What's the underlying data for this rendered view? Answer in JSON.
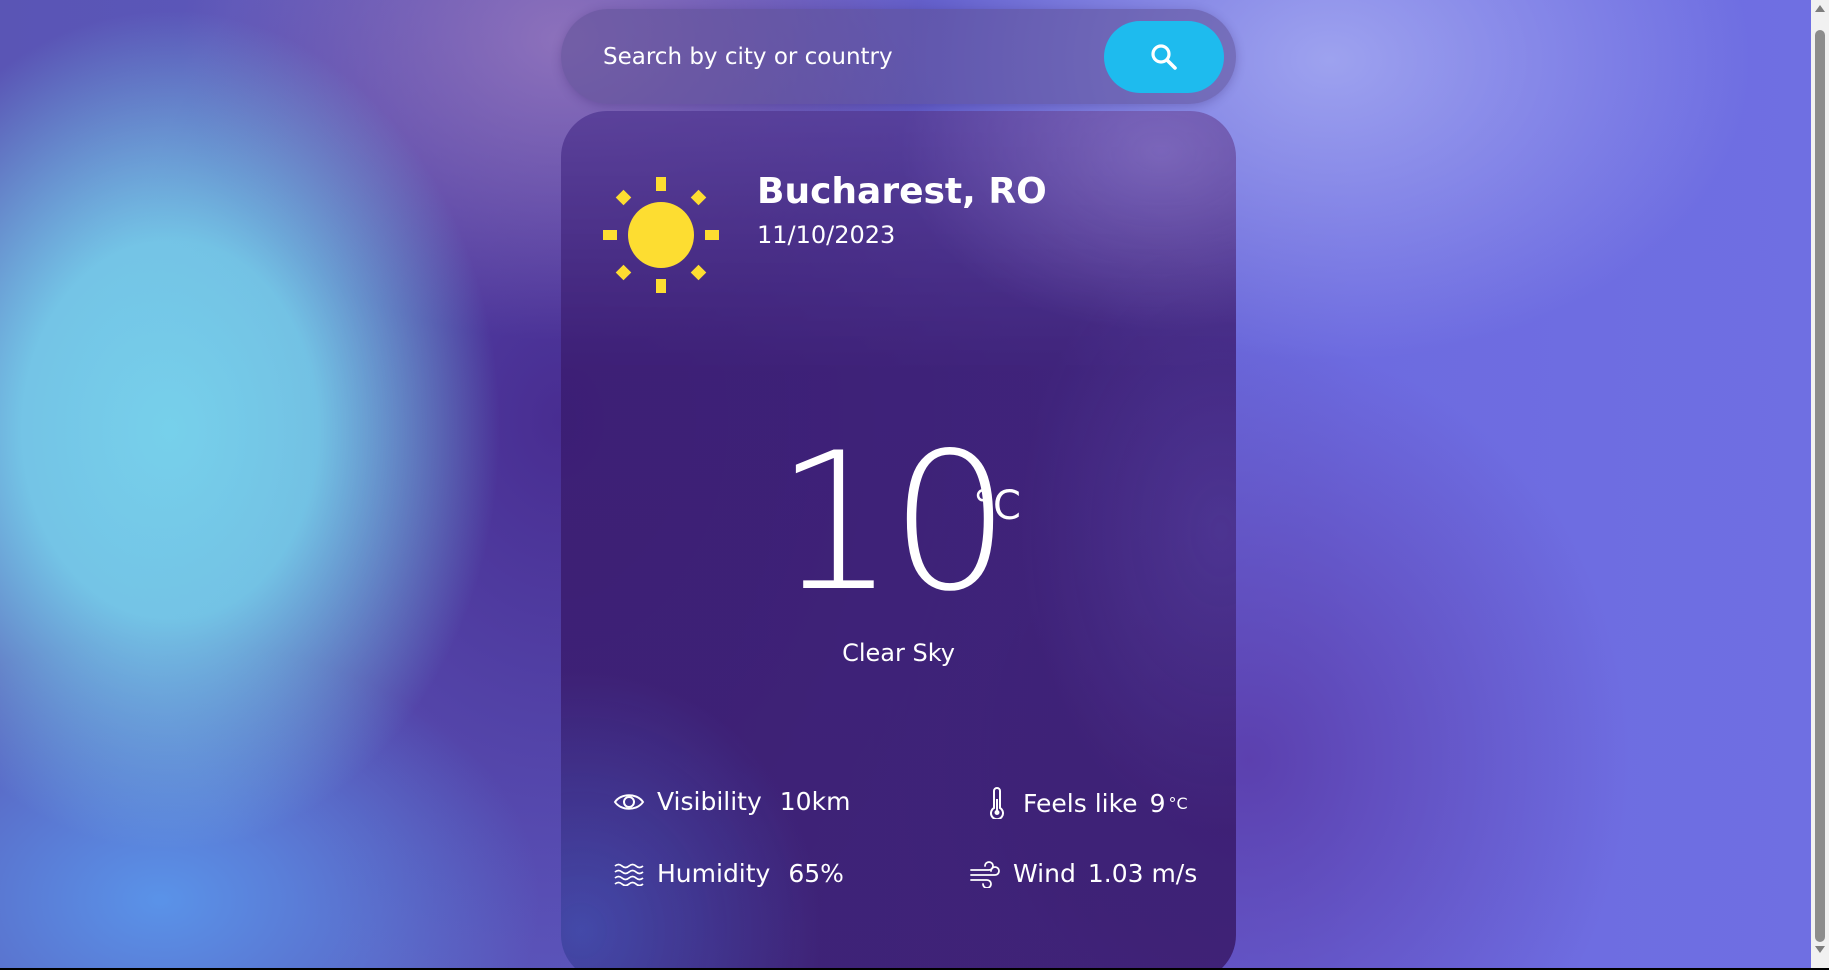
{
  "search": {
    "placeholder": "Search by city or country",
    "value": ""
  },
  "current": {
    "location": "Bucharest, RO",
    "date": "11/10/2023",
    "icon": "sun-icon",
    "temperature": "10",
    "unit": "°C",
    "condition": "Clear Sky"
  },
  "details": {
    "visibility": {
      "label": "Visibility",
      "value": "10km",
      "icon": "eye-icon"
    },
    "feels_like": {
      "label": "Feels like",
      "value": "9",
      "unit": "°C",
      "icon": "thermometer-icon"
    },
    "humidity": {
      "label": "Humidity",
      "value": "65%",
      "icon": "waves-icon"
    },
    "wind": {
      "label": "Wind",
      "value": "1.03 m/s",
      "icon": "wind-icon"
    }
  },
  "colors": {
    "accent": "#1ebbee",
    "sun": "#fddd31",
    "text": "#ffffff"
  }
}
